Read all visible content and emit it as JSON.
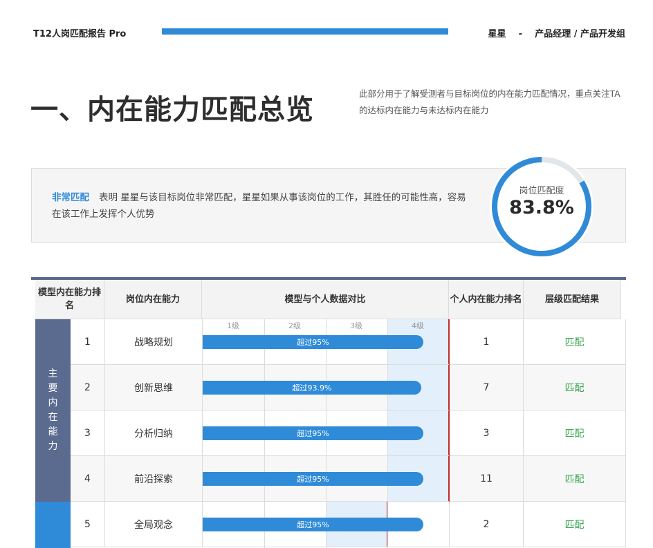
{
  "header": {
    "report_title": "T12人岗匹配报告 Pro",
    "person": "星星",
    "separator": "-",
    "role": "产品经理 / 产品开发组"
  },
  "section": {
    "title": "一、内在能力匹配总览",
    "description": "此部分用于了解受测者与目标岗位的内在能力匹配情况，重点关注TA的达标内在能力与未达标内在能力"
  },
  "summary": {
    "level": "非常匹配",
    "text": "表明 星星与该目标岗位非常匹配，星星如果从事该岗位的工作，其胜任的可能性高，容易在该工作上发挥个人优势"
  },
  "gauge": {
    "label": "岗位匹配度",
    "value_text": "83.8%",
    "value": 83.8,
    "color": "#2f8bd8",
    "track_color": "#e1e6ea"
  },
  "table": {
    "headers": {
      "model_rank": "模型内在能力排名",
      "ability": "岗位内在能力",
      "compare": "模型与个人数据对比",
      "personal_rank": "个人内在能力排名",
      "result": "层级匹配结果"
    },
    "levels": [
      "1级",
      "2级",
      "3级",
      "4级"
    ],
    "groups": [
      {
        "label": "主要内在能力",
        "color": "#5b6a8f"
      },
      {
        "label": "",
        "color": "#2f8bd8"
      }
    ],
    "rows": [
      {
        "rank": "1",
        "ability": "战略规划",
        "bar_label": "超过95%",
        "percentile": 95,
        "target_level": 4,
        "personal_rank": "1",
        "result": "匹配"
      },
      {
        "rank": "2",
        "ability": "创新思维",
        "bar_label": "超过93.9%",
        "percentile": 93.9,
        "target_level": 4,
        "personal_rank": "7",
        "result": "匹配"
      },
      {
        "rank": "3",
        "ability": "分析归纳",
        "bar_label": "超过95%",
        "percentile": 95,
        "target_level": 4,
        "personal_rank": "3",
        "result": "匹配"
      },
      {
        "rank": "4",
        "ability": "前沿探索",
        "bar_label": "超过95%",
        "percentile": 95,
        "target_level": 4,
        "personal_rank": "11",
        "result": "匹配"
      },
      {
        "rank": "5",
        "ability": "全局观念",
        "bar_label": "超过95%",
        "percentile": 95,
        "target_level": 3,
        "personal_rank": "2",
        "result": "匹配"
      }
    ]
  }
}
